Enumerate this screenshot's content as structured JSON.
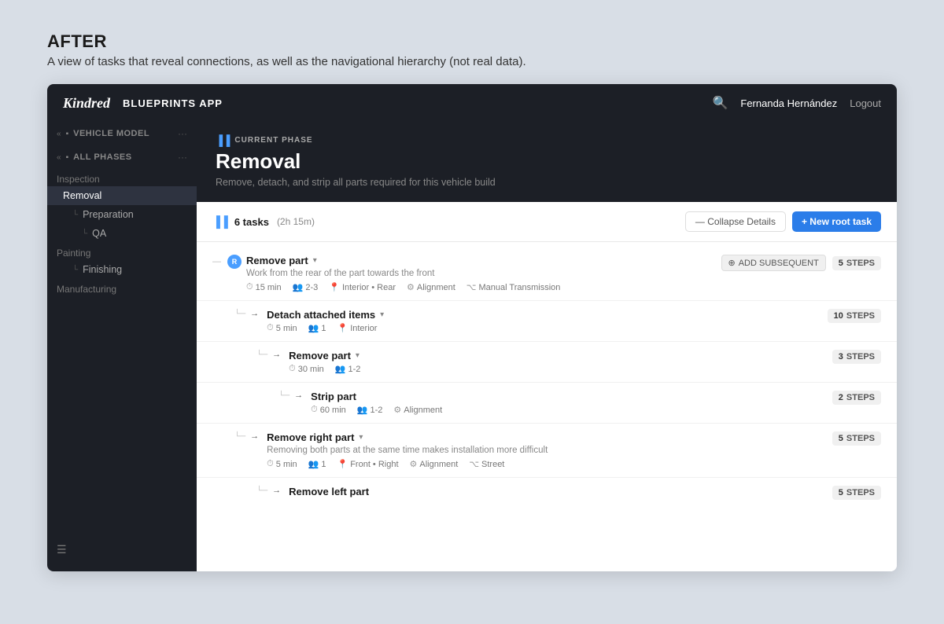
{
  "page": {
    "heading": "AFTER",
    "subheading": "A view of tasks that reveal connections, as well as the navigational hierarchy (not real data)."
  },
  "topnav": {
    "logo": "Kindred",
    "app_name": "BLUEPRINTS APP",
    "search_icon": "🔍",
    "user_name": "Fernanda Hernández",
    "logout_label": "Logout"
  },
  "sidebar": {
    "vehicle_model_label": "VEHICLE MODEL",
    "all_phases_label": "ALL PHASES",
    "groups": [
      {
        "label": "Inspection",
        "items": [
          {
            "label": "Removal",
            "active": true,
            "indent": 0
          },
          {
            "label": "Preparation",
            "indent": 1
          },
          {
            "label": "QA",
            "indent": 2
          }
        ]
      },
      {
        "label": "Painting",
        "items": [
          {
            "label": "Finishing",
            "indent": 1
          }
        ]
      },
      {
        "label": "Manufacturing",
        "items": []
      }
    ]
  },
  "phase": {
    "current_phase_label": "CURRENT PHASE",
    "title": "Removal",
    "description": "Remove, detach, and strip all parts required for this vehicle build"
  },
  "tasks_toolbar": {
    "icon": "▐▐",
    "tasks_label": "6 tasks",
    "tasks_time": "(2h 15m)",
    "collapse_btn": "— Collapse Details",
    "new_task_btn": "+ New root task"
  },
  "tasks": [
    {
      "id": 1,
      "indent": 0,
      "icon": "R",
      "title": "Remove part",
      "has_dropdown": true,
      "description": "Work from the rear of the part towards the front",
      "meta": [
        {
          "icon": "⏱",
          "text": "15 min"
        },
        {
          "icon": "👥",
          "text": "2-3"
        },
        {
          "icon": "📍",
          "text": "Interior • Rear"
        },
        {
          "icon": "⚙",
          "text": "Alignment"
        },
        {
          "icon": "⌥",
          "text": "Manual Transmission"
        }
      ],
      "show_add_subsequent": true,
      "steps_count": "5",
      "steps_label": "STEPS"
    },
    {
      "id": 2,
      "indent": 1,
      "icon": null,
      "title": "Detach attached items",
      "has_dropdown": true,
      "description": null,
      "meta": [
        {
          "icon": "⏱",
          "text": "5 min"
        },
        {
          "icon": "👥",
          "text": "1"
        },
        {
          "icon": "📍",
          "text": "Interior"
        }
      ],
      "show_add_subsequent": false,
      "steps_count": "10",
      "steps_label": "STEPS"
    },
    {
      "id": 3,
      "indent": 2,
      "icon": null,
      "title": "Remove part",
      "has_dropdown": true,
      "description": null,
      "meta": [
        {
          "icon": "⏱",
          "text": "30 min"
        },
        {
          "icon": "👥",
          "text": "1-2"
        }
      ],
      "show_add_subsequent": false,
      "steps_count": "3",
      "steps_label": "STEPS"
    },
    {
      "id": 4,
      "indent": 3,
      "icon": null,
      "title": "Strip part",
      "has_dropdown": false,
      "description": null,
      "meta": [
        {
          "icon": "⏱",
          "text": "60 min"
        },
        {
          "icon": "👥",
          "text": "1-2"
        },
        {
          "icon": "⚙",
          "text": "Alignment"
        }
      ],
      "show_add_subsequent": false,
      "steps_count": "2",
      "steps_label": "STEPS"
    },
    {
      "id": 5,
      "indent": 1,
      "icon": null,
      "title": "Remove right part",
      "has_dropdown": true,
      "description": "Removing both parts at the same time makes installation more difficult",
      "meta": [
        {
          "icon": "⏱",
          "text": "5 min"
        },
        {
          "icon": "👥",
          "text": "1"
        },
        {
          "icon": "📍",
          "text": "Front • Right"
        },
        {
          "icon": "⚙",
          "text": "Alignment"
        },
        {
          "icon": "⌥",
          "text": "Street"
        }
      ],
      "show_add_subsequent": false,
      "steps_count": "5",
      "steps_label": "STEPS"
    },
    {
      "id": 6,
      "indent": 2,
      "icon": null,
      "title": "Remove left part",
      "has_dropdown": false,
      "description": null,
      "meta": [],
      "show_add_subsequent": false,
      "steps_count": "5",
      "steps_label": "STEPS"
    }
  ]
}
